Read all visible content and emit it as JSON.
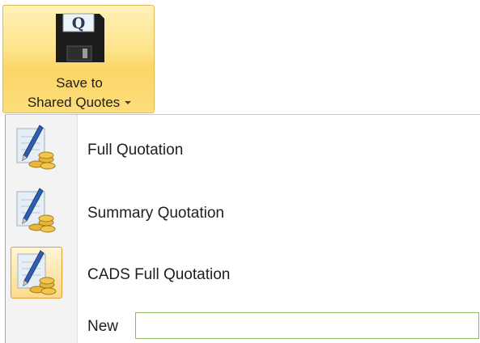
{
  "ribbon": {
    "save_button": {
      "icon": "floppy-disk-q-icon",
      "label_line1": "Save to",
      "label_line2": "Shared Quotes",
      "highlight_color": "#fde48b"
    }
  },
  "menu": {
    "items": [
      {
        "label": "Full Quotation",
        "icon": "quotation-pencil-coins-icon",
        "selected": false
      },
      {
        "label": "Summary Quotation",
        "icon": "quotation-pencil-coins-icon",
        "selected": false
      },
      {
        "label": "CADS Full Quotation",
        "icon": "quotation-pencil-coins-icon",
        "selected": true
      }
    ],
    "new_field": {
      "label": "New",
      "value": "",
      "border_color": "#8cba5a"
    }
  }
}
